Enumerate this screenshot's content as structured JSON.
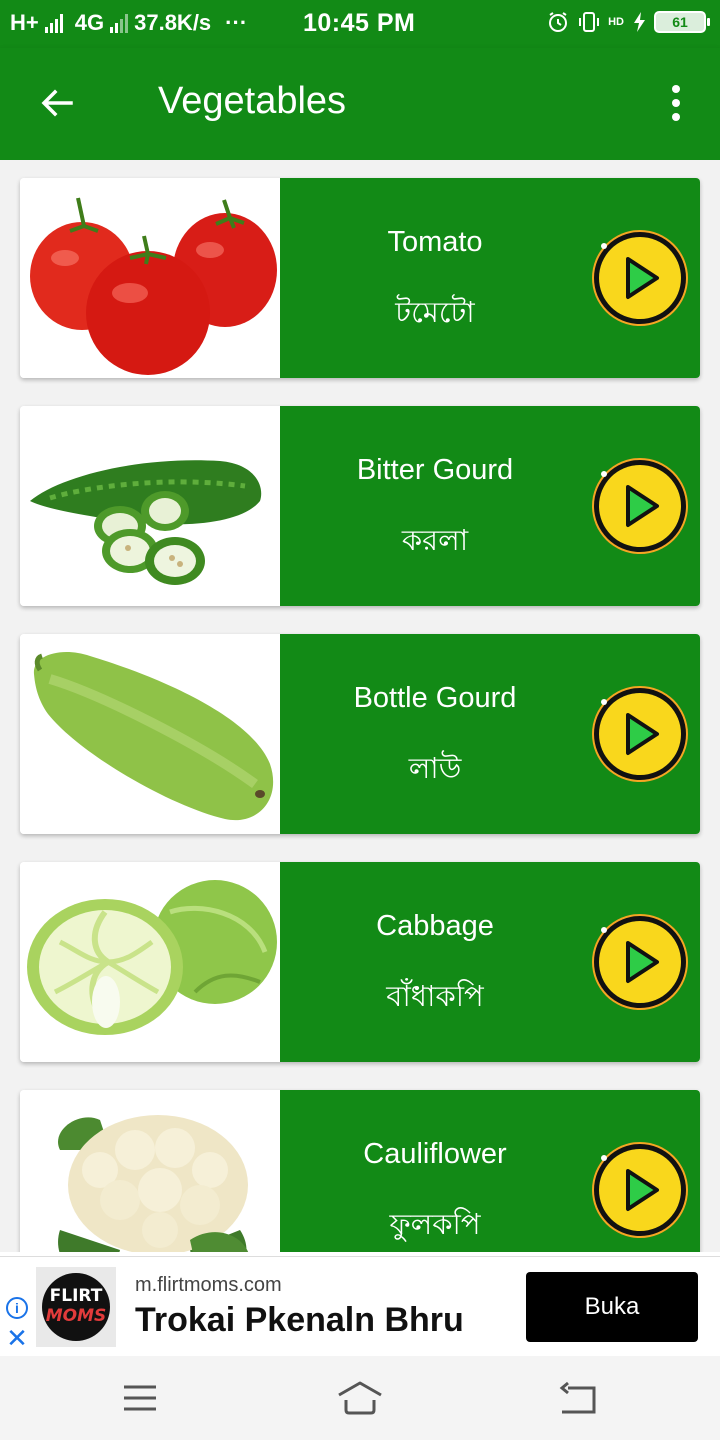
{
  "status_bar": {
    "network_left": "H+",
    "network_type": "4G",
    "speed": "37.8K/s",
    "dots": "···",
    "time": "10:45  PM",
    "hd_label": "HD",
    "battery": "61"
  },
  "app_bar": {
    "title": "Vegetables",
    "back_icon": "arrow-left-icon",
    "menu_icon": "more-vertical-icon"
  },
  "colors": {
    "primary_green": "#128a16",
    "play_yellow": "#f9d71c",
    "play_ring": "#f5a623",
    "ad_button": "#000000"
  },
  "vegetables": [
    {
      "english": "Tomato",
      "bengali": "টমেটো",
      "image": "tomato-image"
    },
    {
      "english": "Bitter Gourd",
      "bengali": "করলা",
      "image": "bitter-gourd-image"
    },
    {
      "english": "Bottle Gourd",
      "bengali": "লাউ",
      "image": "bottle-gourd-image"
    },
    {
      "english": "Cabbage",
      "bengali": "বাঁধাকপি",
      "image": "cabbage-image"
    },
    {
      "english": "Cauliflower",
      "bengali": "ফুলকপি",
      "image": "cauliflower-image"
    }
  ],
  "ad": {
    "logo_line1": "FLIRT",
    "logo_line2": "MOMS",
    "url": "m.flirtmoms.com",
    "headline": "Trokai Pkenaln Bhru",
    "button": "Buka",
    "info_icon": "info-icon",
    "close_icon": "close-icon"
  },
  "nav_bar": {
    "menu_icon": "menu-icon",
    "home_icon": "home-icon",
    "back_icon": "back-icon"
  }
}
